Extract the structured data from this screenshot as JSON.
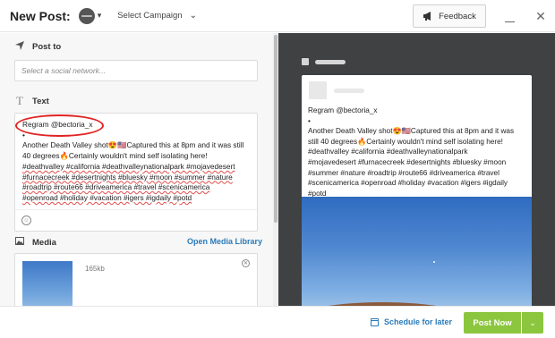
{
  "header": {
    "title": "New Post:",
    "campaign_label": "Select Campaign",
    "feedback_label": "Feedback"
  },
  "post_to": {
    "label": "Post to",
    "placeholder": "Select a social network..."
  },
  "text_section": {
    "label": "Text",
    "lines": [
      "Regram @bectoria_x",
      "•",
      "Another Death Valley shot😍🇺🇸Captured this at 8pm and it was still",
      "40 degrees🔥Certainly wouldn't mind self isolating here!"
    ],
    "hashtag_lines": [
      "#deathvalley #california #deathvalleynationalpark #mojavedesert",
      "#furnacecreek #desertnights #bluesky #moon #summer #nature",
      "#roadtrip #route66 #driveamerica #travel #scenicamerica",
      "#openroad #holiday #vacation #igers #igdaily #potd"
    ]
  },
  "media": {
    "label": "Media",
    "open_library_label": "Open Media Library",
    "file_size": "165kb"
  },
  "preview": {
    "lines": [
      "Regram @bectoria_x",
      "•",
      "Another Death Valley shot😍🇺🇸Captured this at 8pm and it was",
      "still 40 degrees🔥Certainly wouldn't mind self isolating here!",
      "#deathvalley #california #deathvalleynationalpark",
      "#mojavedesert #furnacecreek #desertnights #bluesky #moon",
      "#summer #nature #roadtrip #route66 #driveamerica #travel",
      "#scenicamerica #openroad #holiday #vacation #igers #igdaily",
      "#potd"
    ]
  },
  "footer": {
    "schedule_label": "Schedule for later",
    "post_now_label": "Post Now"
  },
  "colors": {
    "accent_blue": "#2b7bb9",
    "post_green": "#8cc63f",
    "highlight_red": "#e02424",
    "preview_bg": "#3f4142"
  },
  "icons": {
    "post_to": "paper-plane-icon",
    "text": "text-t-icon",
    "media": "image-icon",
    "feedback": "megaphone-icon",
    "schedule": "calendar-icon"
  }
}
